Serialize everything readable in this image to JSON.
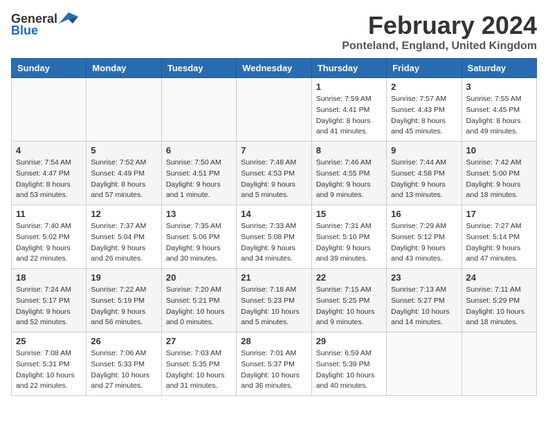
{
  "logo": {
    "text_general": "General",
    "text_blue": "Blue"
  },
  "title": "February 2024",
  "subtitle": "Ponteland, England, United Kingdom",
  "weekdays": [
    "Sunday",
    "Monday",
    "Tuesday",
    "Wednesday",
    "Thursday",
    "Friday",
    "Saturday"
  ],
  "weeks": [
    [
      {
        "day": "",
        "info": ""
      },
      {
        "day": "",
        "info": ""
      },
      {
        "day": "",
        "info": ""
      },
      {
        "day": "",
        "info": ""
      },
      {
        "day": "1",
        "info": "Sunrise: 7:59 AM\nSunset: 4:41 PM\nDaylight: 8 hours\nand 41 minutes."
      },
      {
        "day": "2",
        "info": "Sunrise: 7:57 AM\nSunset: 4:43 PM\nDaylight: 8 hours\nand 45 minutes."
      },
      {
        "day": "3",
        "info": "Sunrise: 7:55 AM\nSunset: 4:45 PM\nDaylight: 8 hours\nand 49 minutes."
      }
    ],
    [
      {
        "day": "4",
        "info": "Sunrise: 7:54 AM\nSunset: 4:47 PM\nDaylight: 8 hours\nand 53 minutes."
      },
      {
        "day": "5",
        "info": "Sunrise: 7:52 AM\nSunset: 4:49 PM\nDaylight: 8 hours\nand 57 minutes."
      },
      {
        "day": "6",
        "info": "Sunrise: 7:50 AM\nSunset: 4:51 PM\nDaylight: 9 hours\nand 1 minute."
      },
      {
        "day": "7",
        "info": "Sunrise: 7:48 AM\nSunset: 4:53 PM\nDaylight: 9 hours\nand 5 minutes."
      },
      {
        "day": "8",
        "info": "Sunrise: 7:46 AM\nSunset: 4:55 PM\nDaylight: 9 hours\nand 9 minutes."
      },
      {
        "day": "9",
        "info": "Sunrise: 7:44 AM\nSunset: 4:58 PM\nDaylight: 9 hours\nand 13 minutes."
      },
      {
        "day": "10",
        "info": "Sunrise: 7:42 AM\nSunset: 5:00 PM\nDaylight: 9 hours\nand 18 minutes."
      }
    ],
    [
      {
        "day": "11",
        "info": "Sunrise: 7:40 AM\nSunset: 5:02 PM\nDaylight: 9 hours\nand 22 minutes."
      },
      {
        "day": "12",
        "info": "Sunrise: 7:37 AM\nSunset: 5:04 PM\nDaylight: 9 hours\nand 26 minutes."
      },
      {
        "day": "13",
        "info": "Sunrise: 7:35 AM\nSunset: 5:06 PM\nDaylight: 9 hours\nand 30 minutes."
      },
      {
        "day": "14",
        "info": "Sunrise: 7:33 AM\nSunset: 5:08 PM\nDaylight: 9 hours\nand 34 minutes."
      },
      {
        "day": "15",
        "info": "Sunrise: 7:31 AM\nSunset: 5:10 PM\nDaylight: 9 hours\nand 39 minutes."
      },
      {
        "day": "16",
        "info": "Sunrise: 7:29 AM\nSunset: 5:12 PM\nDaylight: 9 hours\nand 43 minutes."
      },
      {
        "day": "17",
        "info": "Sunrise: 7:27 AM\nSunset: 5:14 PM\nDaylight: 9 hours\nand 47 minutes."
      }
    ],
    [
      {
        "day": "18",
        "info": "Sunrise: 7:24 AM\nSunset: 5:17 PM\nDaylight: 9 hours\nand 52 minutes."
      },
      {
        "day": "19",
        "info": "Sunrise: 7:22 AM\nSunset: 5:19 PM\nDaylight: 9 hours\nand 56 minutes."
      },
      {
        "day": "20",
        "info": "Sunrise: 7:20 AM\nSunset: 5:21 PM\nDaylight: 10 hours\nand 0 minutes."
      },
      {
        "day": "21",
        "info": "Sunrise: 7:18 AM\nSunset: 5:23 PM\nDaylight: 10 hours\nand 5 minutes."
      },
      {
        "day": "22",
        "info": "Sunrise: 7:15 AM\nSunset: 5:25 PM\nDaylight: 10 hours\nand 9 minutes."
      },
      {
        "day": "23",
        "info": "Sunrise: 7:13 AM\nSunset: 5:27 PM\nDaylight: 10 hours\nand 14 minutes."
      },
      {
        "day": "24",
        "info": "Sunrise: 7:11 AM\nSunset: 5:29 PM\nDaylight: 10 hours\nand 18 minutes."
      }
    ],
    [
      {
        "day": "25",
        "info": "Sunrise: 7:08 AM\nSunset: 5:31 PM\nDaylight: 10 hours\nand 22 minutes."
      },
      {
        "day": "26",
        "info": "Sunrise: 7:06 AM\nSunset: 5:33 PM\nDaylight: 10 hours\nand 27 minutes."
      },
      {
        "day": "27",
        "info": "Sunrise: 7:03 AM\nSunset: 5:35 PM\nDaylight: 10 hours\nand 31 minutes."
      },
      {
        "day": "28",
        "info": "Sunrise: 7:01 AM\nSunset: 5:37 PM\nDaylight: 10 hours\nand 36 minutes."
      },
      {
        "day": "29",
        "info": "Sunrise: 6:59 AM\nSunset: 5:39 PM\nDaylight: 10 hours\nand 40 minutes."
      },
      {
        "day": "",
        "info": ""
      },
      {
        "day": "",
        "info": ""
      }
    ]
  ]
}
